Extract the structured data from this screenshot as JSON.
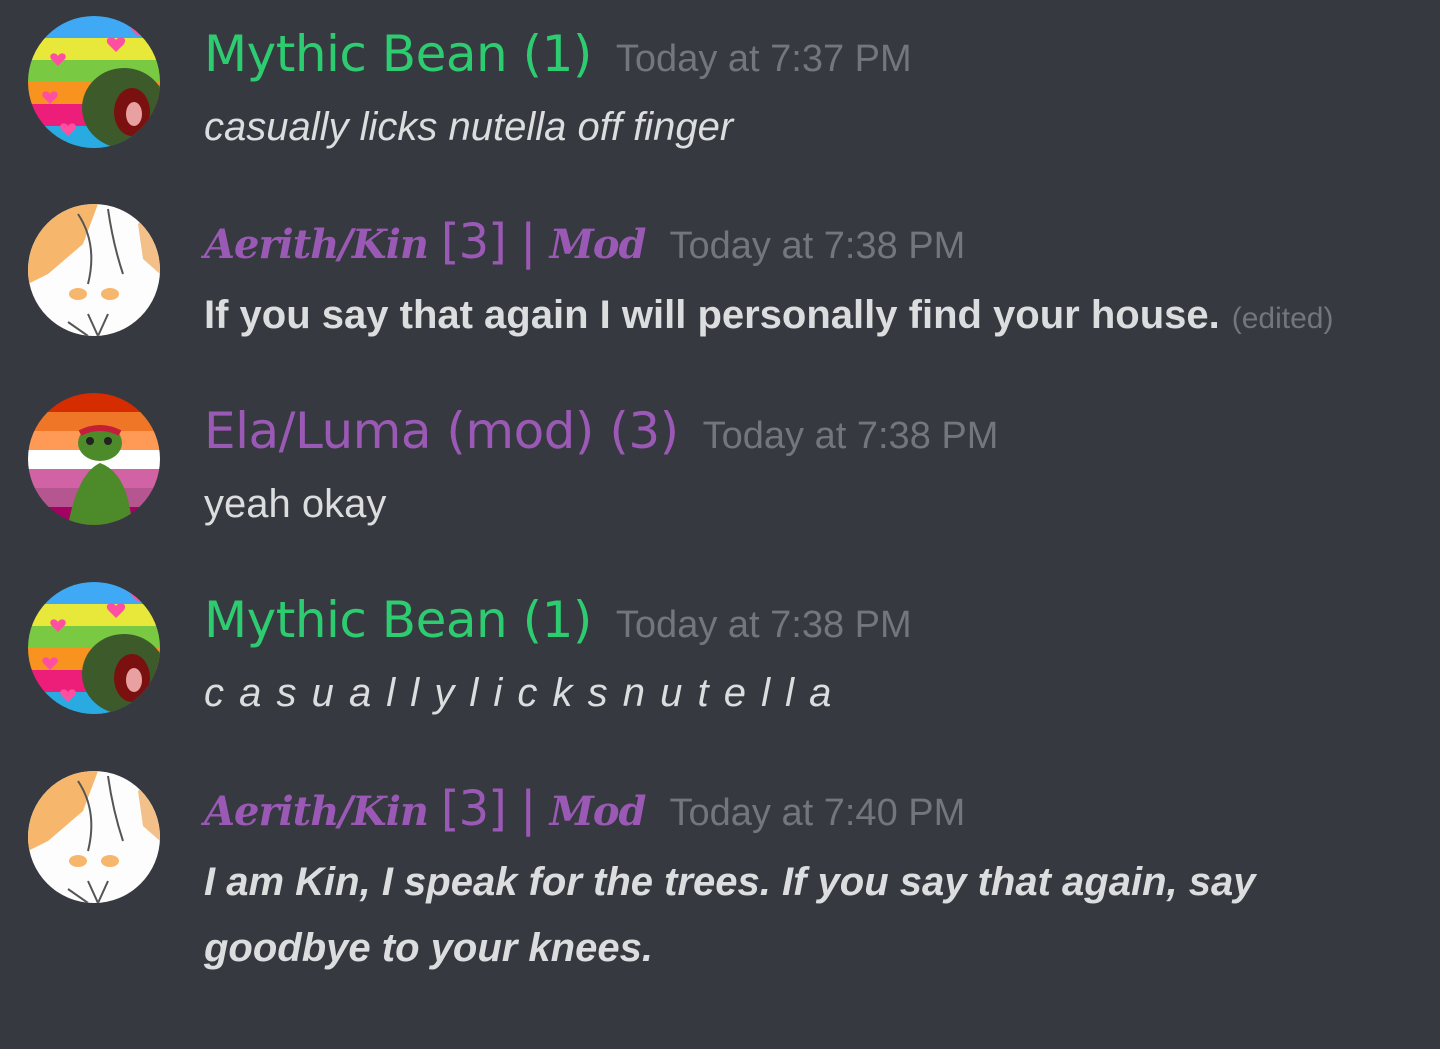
{
  "messages": [
    {
      "username": "Mythic Bean (1)",
      "timestamp": "Today at 7:37 PM",
      "text": "casually licks nutella off finger",
      "avatar": "pride-kermit-avatar"
    },
    {
      "username_fancy": "Aerith/Kin",
      "username_rest": "[3] | ",
      "username_mod": "Mod",
      "timestamp": "Today at 7:38 PM",
      "text": "If you say that again I will personally find your house.",
      "edited": "(edited)",
      "avatar": "anime-character-avatar"
    },
    {
      "username": "Ela/Luma (mod) (3)",
      "timestamp": "Today at 7:38 PM",
      "text": "yeah okay",
      "avatar": "lesbian-flag-kermit-avatar"
    },
    {
      "username": "Mythic Bean (1)",
      "timestamp": "Today at 7:38 PM",
      "text": "c a s u a l l y l i c k s n u t e l l a",
      "avatar": "pride-kermit-avatar"
    },
    {
      "username_fancy": "Aerith/Kin",
      "username_rest": "[3] | ",
      "username_mod": "Mod",
      "timestamp": "Today at 7:40 PM",
      "text": "I am Kin, I speak for the trees. If you say that again, say goodbye to your knees.",
      "avatar": "anime-character-avatar"
    }
  ],
  "colors": {
    "background": "#36393f",
    "green_role": "#2ecc71",
    "purple_role": "#9b59b6",
    "timestamp": "#72767d",
    "text": "#dcddde"
  }
}
